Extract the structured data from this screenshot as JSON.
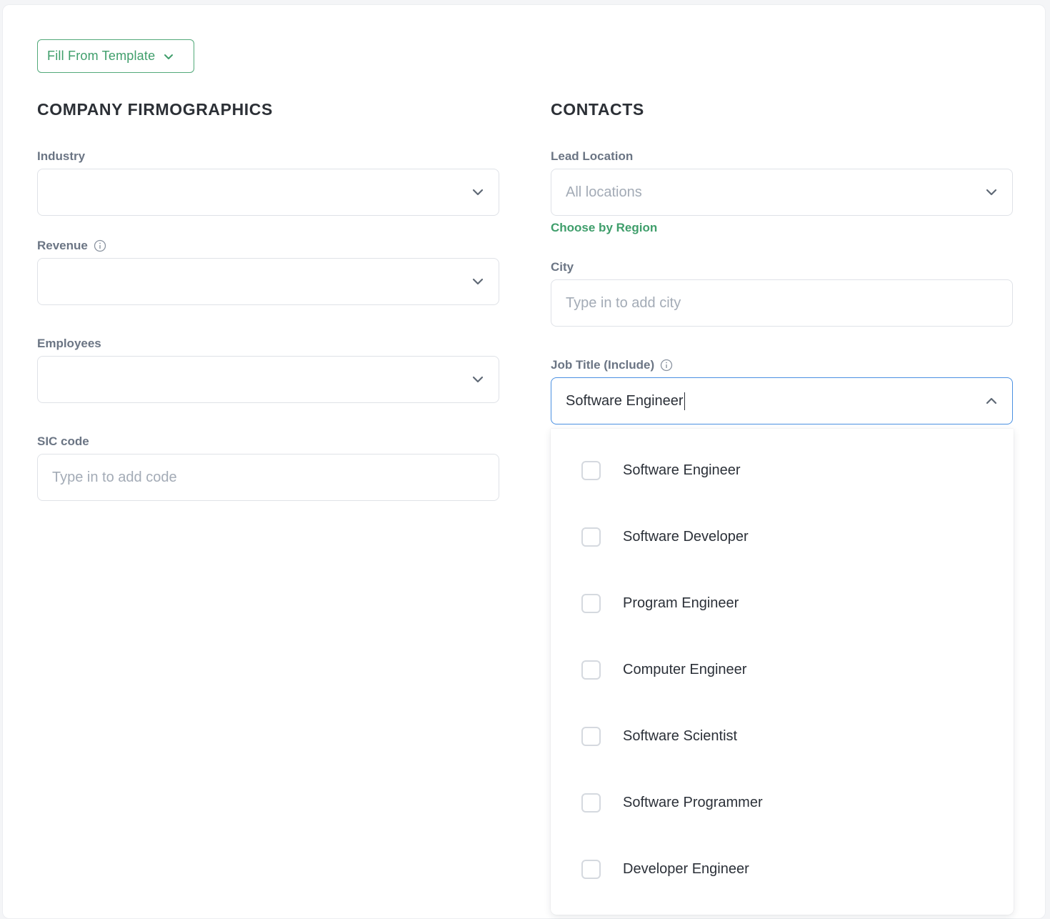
{
  "toolbar": {
    "template_button_label": "Fill From Template"
  },
  "firmographics": {
    "title": "COMPANY FIRMOGRAPHICS",
    "industry_label": "Industry",
    "revenue_label": "Revenue",
    "employees_label": "Employees",
    "sic_label": "SIC code",
    "sic_placeholder": "Type in to add code"
  },
  "contacts": {
    "title": "CONTACTS",
    "lead_location_label": "Lead Location",
    "lead_location_placeholder": "All locations",
    "choose_region_link": "Choose by Region",
    "city_label": "City",
    "city_placeholder": "Type in to add city",
    "job_title_label": "Job Title (Include)",
    "job_title_value": "Software Engineer",
    "job_title_options": [
      "Software Engineer",
      "Software Developer",
      "Program Engineer",
      "Computer Engineer",
      "Software Scientist",
      "Software Programmer",
      "Developer Engineer"
    ]
  },
  "colors": {
    "accent_green": "#3f9e6b",
    "focus_blue": "#4a90e2",
    "label_gray": "#6b7584",
    "placeholder_gray": "#a3abb6",
    "border_gray": "#dfe2e7"
  },
  "icons": {
    "template_chevron": "chevron-down-icon",
    "select_chevron": "chevron-down-icon",
    "job_title_chevron": "chevron-up-icon",
    "info": "info-icon"
  }
}
